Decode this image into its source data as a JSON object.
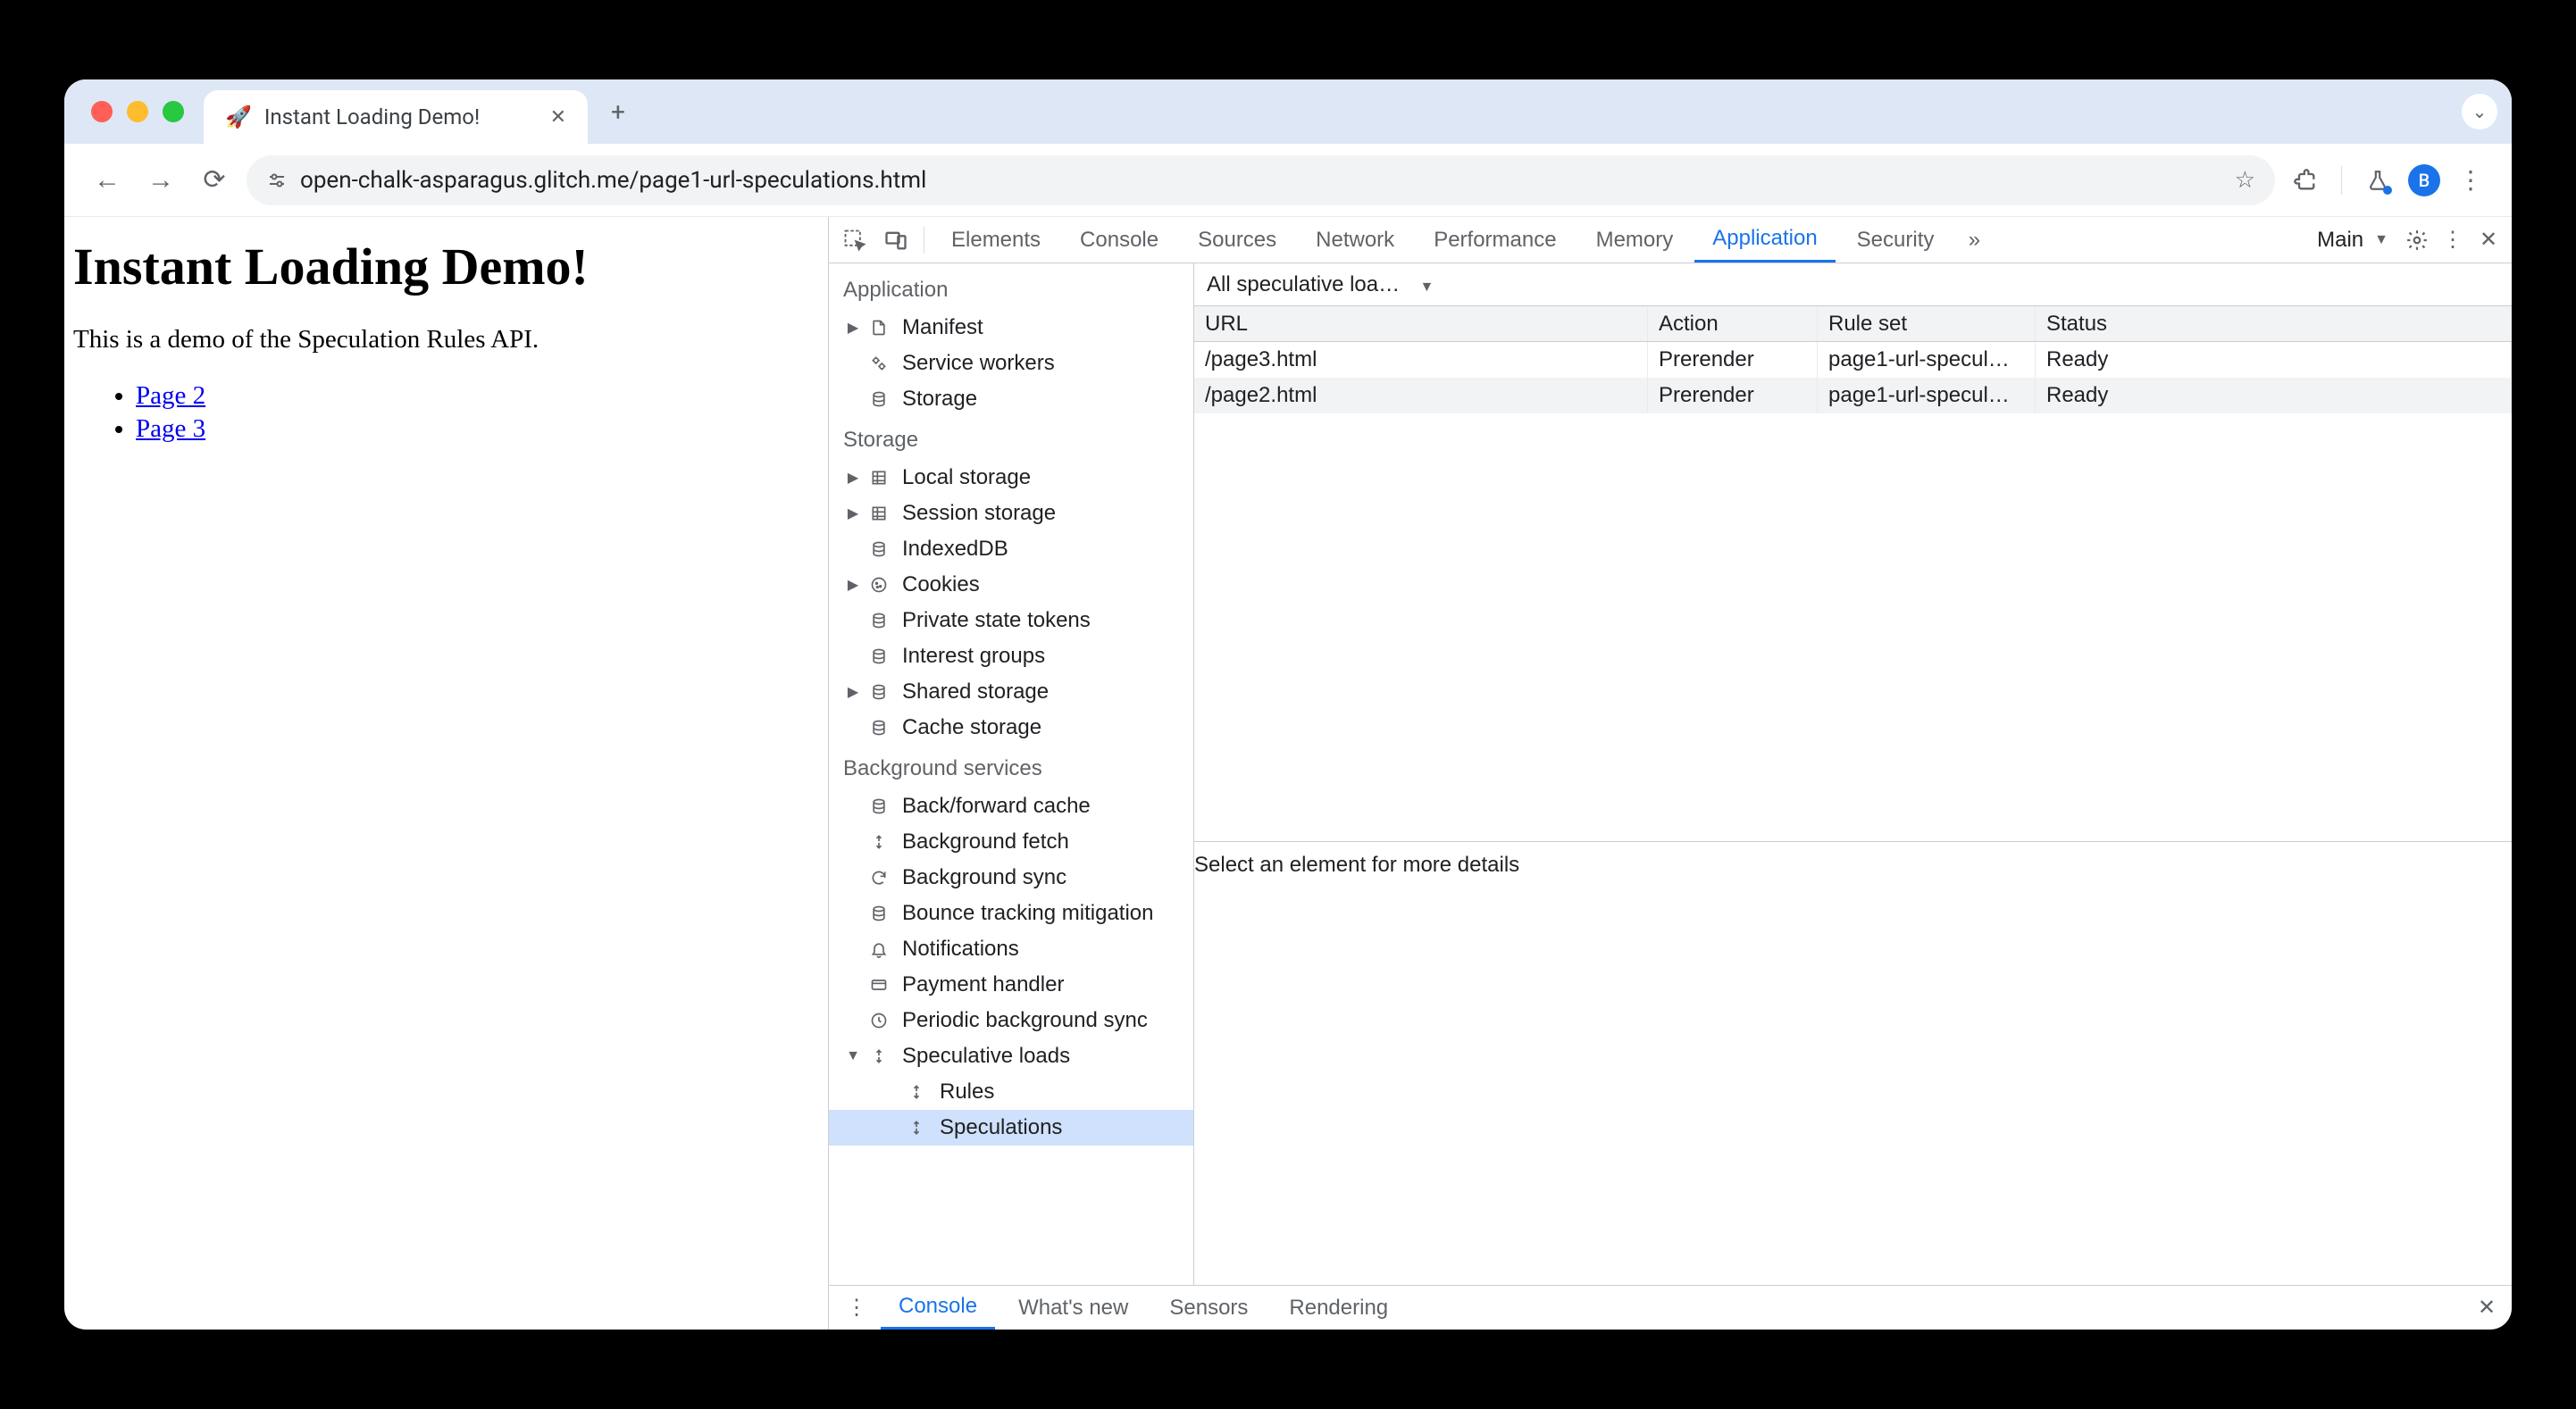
{
  "browser_tab": {
    "favicon": "🚀",
    "title": "Instant Loading Demo!"
  },
  "url": "open-chalk-asparagus.glitch.me/page1-url-speculations.html",
  "avatar_letter": "B",
  "page": {
    "heading": "Instant Loading Demo!",
    "paragraph": "This is a demo of the Speculation Rules API.",
    "links": [
      "Page 2",
      "Page 3"
    ]
  },
  "devtools": {
    "tabs": [
      "Elements",
      "Console",
      "Sources",
      "Network",
      "Performance",
      "Memory",
      "Application",
      "Security"
    ],
    "active_tab": "Application",
    "frame_label": "Main",
    "sidebar": {
      "sections": [
        {
          "title": "Application",
          "items": [
            {
              "label": "Manifest",
              "icon": "file",
              "expandable": true
            },
            {
              "label": "Service workers",
              "icon": "gears"
            },
            {
              "label": "Storage",
              "icon": "db"
            }
          ]
        },
        {
          "title": "Storage",
          "items": [
            {
              "label": "Local storage",
              "icon": "grid",
              "expandable": true
            },
            {
              "label": "Session storage",
              "icon": "grid",
              "expandable": true
            },
            {
              "label": "IndexedDB",
              "icon": "db"
            },
            {
              "label": "Cookies",
              "icon": "cookie",
              "expandable": true
            },
            {
              "label": "Private state tokens",
              "icon": "db"
            },
            {
              "label": "Interest groups",
              "icon": "db"
            },
            {
              "label": "Shared storage",
              "icon": "db",
              "expandable": true
            },
            {
              "label": "Cache storage",
              "icon": "db"
            }
          ]
        },
        {
          "title": "Background services",
          "items": [
            {
              "label": "Back/forward cache",
              "icon": "db"
            },
            {
              "label": "Background fetch",
              "icon": "arrows"
            },
            {
              "label": "Background sync",
              "icon": "sync"
            },
            {
              "label": "Bounce tracking mitigation",
              "icon": "db"
            },
            {
              "label": "Notifications",
              "icon": "bell"
            },
            {
              "label": "Payment handler",
              "icon": "card"
            },
            {
              "label": "Periodic background sync",
              "icon": "clock"
            },
            {
              "label": "Speculative loads",
              "icon": "arrows",
              "expandable": true,
              "expanded": true,
              "children": [
                {
                  "label": "Rules",
                  "icon": "arrows"
                },
                {
                  "label": "Speculations",
                  "icon": "arrows",
                  "selected": true
                }
              ]
            }
          ]
        }
      ]
    },
    "filter": "All speculative loa…",
    "table": {
      "headers": [
        "URL",
        "Action",
        "Rule set",
        "Status"
      ],
      "rows": [
        {
          "url": "/page3.html",
          "action": "Prerender",
          "ruleset": "page1-url-specul…",
          "status": "Ready"
        },
        {
          "url": "/page2.html",
          "action": "Prerender",
          "ruleset": "page1-url-specul…",
          "status": "Ready"
        }
      ]
    },
    "details_hint": "Select an element for more details",
    "drawer": {
      "tabs": [
        "Console",
        "What's new",
        "Sensors",
        "Rendering"
      ],
      "active": "Console"
    }
  }
}
